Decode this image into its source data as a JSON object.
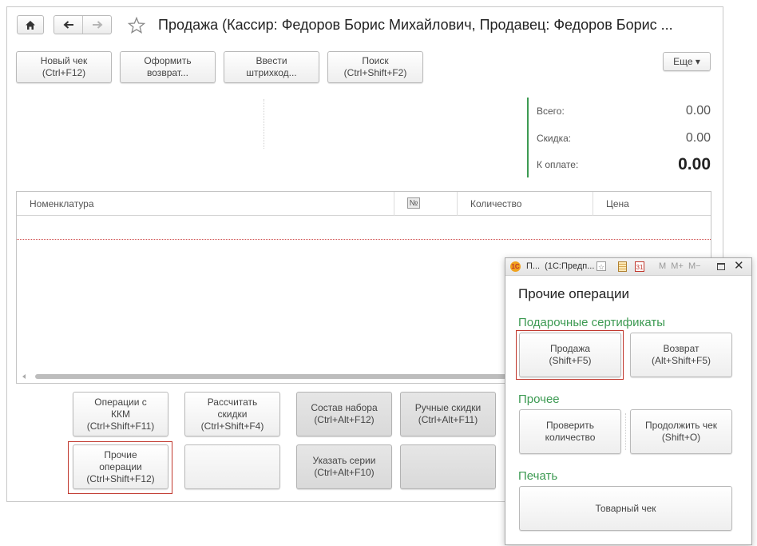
{
  "header": {
    "title": "Продажа (Кассир: Федоров Борис Михайлович, Продавец: Федоров Борис ...",
    "home_icon": "home-icon",
    "back_icon": "arrow-left-icon",
    "forward_icon": "arrow-right-icon",
    "favorite_icon": "star-icon"
  },
  "toolbar": {
    "new_check": "Новый чек\n(Ctrl+F12)",
    "return": "Оформить\nвозврат...",
    "barcode": "Ввести\nштрихкод...",
    "search": "Поиск\n(Ctrl+Shift+F2)",
    "more": "Еще ▾"
  },
  "totals": {
    "total_label": "Всего:",
    "total_value": "0.00",
    "discount_label": "Скидка:",
    "discount_value": "0.00",
    "to_pay_label": "К оплате:",
    "to_pay_value": "0.00"
  },
  "table": {
    "columns": {
      "nomenclature": "Номенклатура",
      "number": "№",
      "quantity": "Количество",
      "price": "Цена"
    }
  },
  "bottom_buttons": {
    "kkm_ops": "Операции с\nККМ\n(Ctrl+Shift+F11)",
    "calc_discounts": "Рассчитать\nскидки\n(Ctrl+Shift+F4)",
    "set_composition": "Состав набора\n(Ctrl+Alt+F12)",
    "manual_discounts": "Ручные скидки\n(Ctrl+Alt+F11)",
    "other_ops": "Прочие\nоперации\n(Ctrl+Shift+F12)",
    "specify_series": "Указать серии\n(Ctrl+Alt+F10)"
  },
  "popup": {
    "titlebar": "П...  (1С:Предп...",
    "titlebar_m": "M  M+  M−",
    "heading": "Прочие операции",
    "gift_section": "Подарочные сертификаты",
    "sale_button": "Продажа\n(Shift+F5)",
    "return_button": "Возврат\n(Alt+Shift+F5)",
    "other_section": "Прочее",
    "check_qty_button": "Проверить\nколичество",
    "continue_check_button": "Продолжить чек\n(Shift+O)",
    "print_section": "Печать",
    "receipt_button": "Товарный чек"
  },
  "colors": {
    "accent_green": "#3c9a52",
    "highlight_red": "#c0362c"
  }
}
